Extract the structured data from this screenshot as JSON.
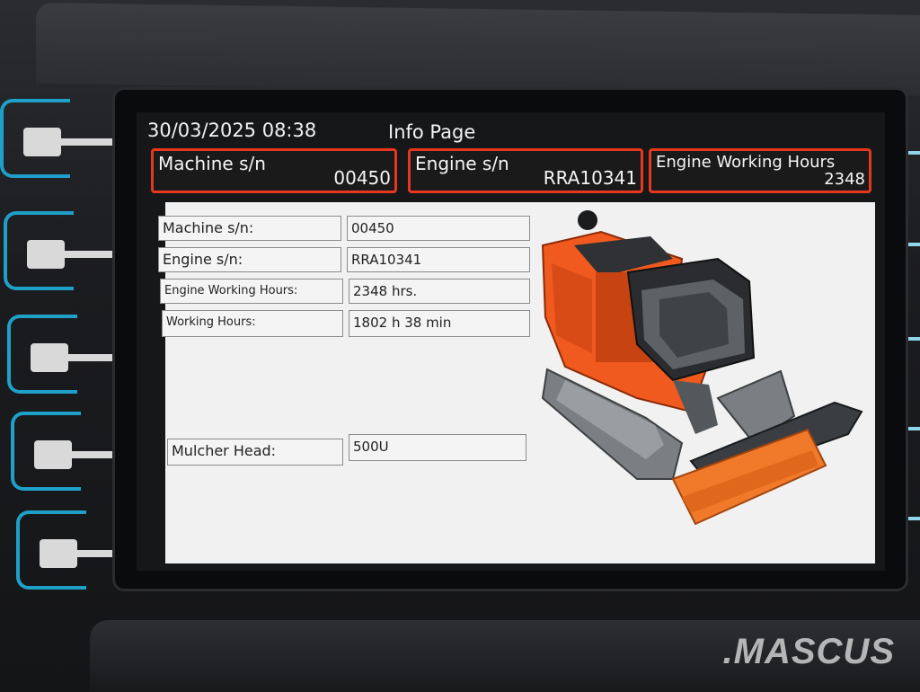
{
  "header": {
    "datetime": "30/03/2025 08:38",
    "title": "Info Page"
  },
  "summary_boxes": [
    {
      "label": "Machine s/n",
      "value": "00450"
    },
    {
      "label": "Engine s/n",
      "value": "RRA10341"
    },
    {
      "label": "Engine Working Hours",
      "value": "2348"
    }
  ],
  "details": {
    "machine_sn": {
      "label": "Machine s/n:",
      "value": "00450"
    },
    "engine_sn": {
      "label": "Engine s/n:",
      "value": "RRA10341"
    },
    "engine_working_hours": {
      "label": "Engine Working Hours:",
      "value": "2348 hrs."
    },
    "working_hours": {
      "label": "Working Hours:",
      "value": "1802 h 38 min"
    },
    "mulcher_head": {
      "label": "Mulcher Head:",
      "value": "500U"
    }
  },
  "softkeys": [
    "softkey-1",
    "softkey-2",
    "softkey-3",
    "softkey-4",
    "softkey-5"
  ],
  "watermark": ".MASCUS",
  "colors": {
    "accent_red": "#e5381e",
    "softkey_blue": "#1fa0c8",
    "machine_orange": "#f05a1e",
    "panel_bg": "#f1f1f1"
  }
}
